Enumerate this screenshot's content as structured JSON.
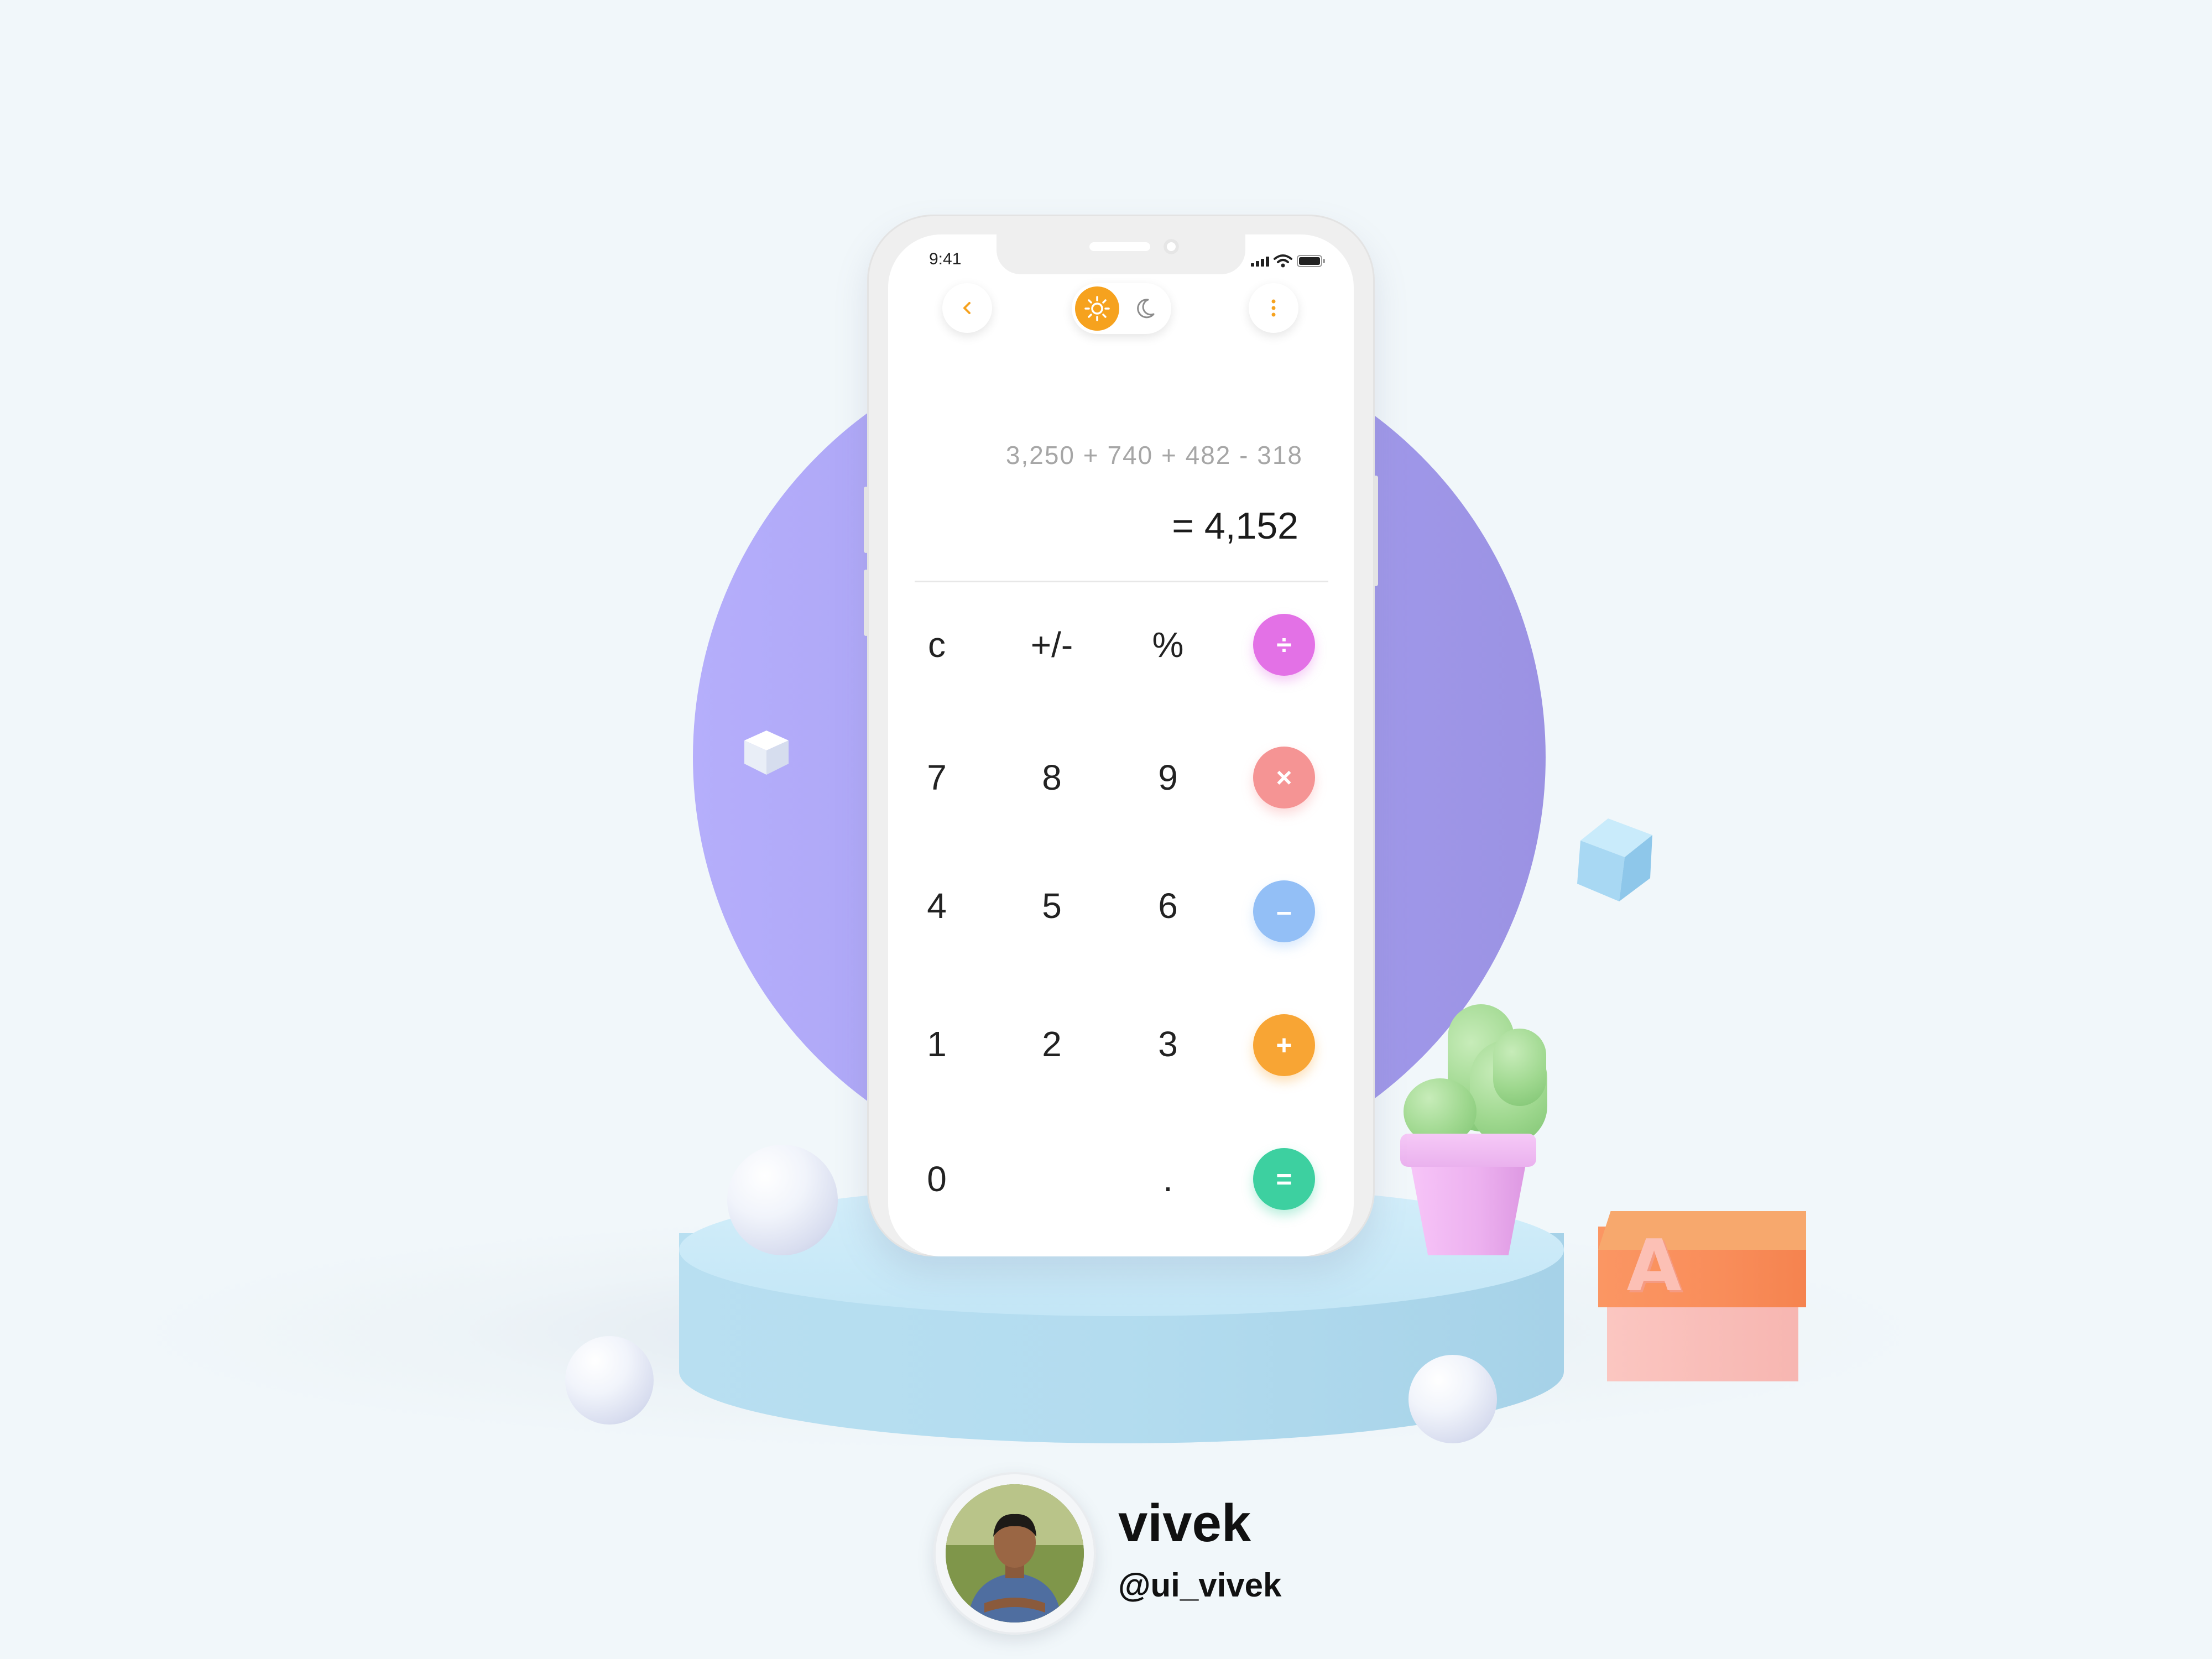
{
  "status_bar": {
    "time": "9:41"
  },
  "header": {
    "back_icon": "chevron-left-icon",
    "theme_light_icon": "sun-icon",
    "theme_dark_icon": "moon-icon",
    "menu_icon": "more-vertical-icon",
    "active_theme": "light"
  },
  "display": {
    "expression": "3,250 + 740 + 482 - 318",
    "result": "= 4,152"
  },
  "keypad": {
    "rows": [
      [
        "c",
        "+/-",
        "%"
      ],
      [
        "7",
        "8",
        "9"
      ],
      [
        "4",
        "5",
        "6"
      ],
      [
        "1",
        "2",
        "3"
      ],
      [
        "0",
        "",
        "."
      ]
    ],
    "operators": [
      {
        "label": "÷",
        "name": "divide",
        "color": "#e371e6"
      },
      {
        "label": "×",
        "name": "multiply",
        "color": "#f59494"
      },
      {
        "label": "–",
        "name": "subtract",
        "color": "#93bff6"
      },
      {
        "label": "+",
        "name": "add",
        "color": "#f8a534"
      },
      {
        "label": "=",
        "name": "equals",
        "color": "#3dd0a0"
      }
    ]
  },
  "author": {
    "name": "vivek",
    "handle": "@ui_vivek"
  },
  "decor": {
    "block_letter": "A",
    "accent_color": "#f6a21e",
    "circle_color": "#ab9ff5",
    "pedestal_color": "#b8dff1"
  }
}
